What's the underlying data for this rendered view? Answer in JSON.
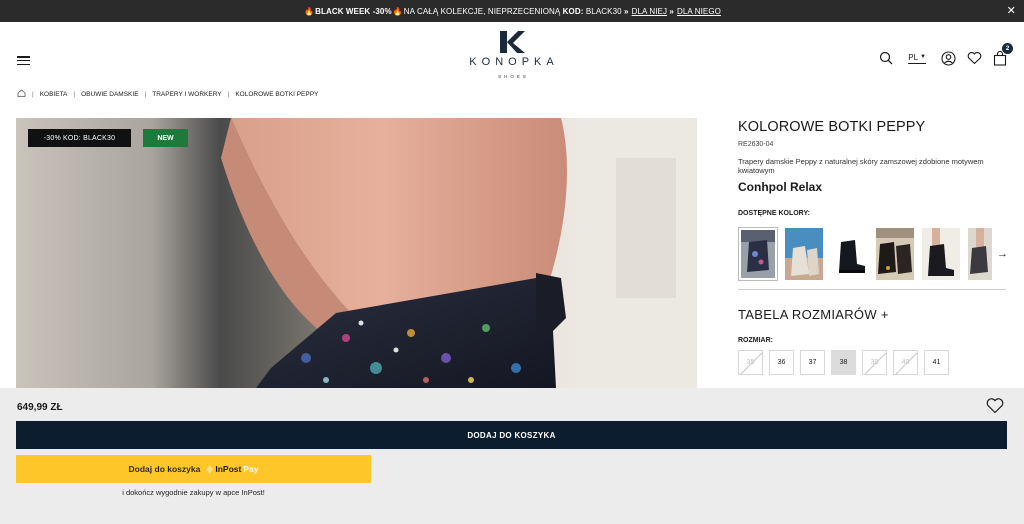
{
  "promo": {
    "part1": "BLACK WEEK -30%",
    "part2": "NA CAŁĄ KOLEKCJE, NIEPRZECENIONĄ",
    "code_label": "KOD:",
    "code": "BLACK30",
    "link1": "DLA NIEJ",
    "link2": "DLA NIEGO",
    "arrows": "»",
    "close": "✕"
  },
  "logo": {
    "name": "KONOPKA",
    "sub": "SHOES"
  },
  "header": {
    "language": "PL",
    "cart_count": "2"
  },
  "breadcrumb": [
    "KOBIETA",
    "OBUWIE DAMSKIE",
    "TRAPERY I WORKERY",
    "KOLOROWE BOTKI PEPPY"
  ],
  "badges": {
    "promo": "-30% KOD: BLACK30",
    "new": "NEW"
  },
  "product": {
    "title": "KOLOROWE BOTKI PEPPY",
    "sku": "RE2630-04",
    "description": "Trapery damskie Peppy z naturalnej skóry zamszowej zdobione motywem kwiatowym",
    "brand": "Conhpol Relax",
    "colors_label": "DOSTĘPNE KOLORY:",
    "size_table": "TABELA ROZMIARÓW +",
    "size_label": "ROZMIAR:",
    "sizes": [
      {
        "label": "35",
        "available": false
      },
      {
        "label": "36",
        "available": true
      },
      {
        "label": "37",
        "available": true
      },
      {
        "label": "38",
        "available": true,
        "selected": true
      },
      {
        "label": "39",
        "available": false
      },
      {
        "label": "40",
        "available": false
      },
      {
        "label": "41",
        "available": true
      }
    ]
  },
  "bottom": {
    "price": "649,99 ZŁ",
    "add_to_cart": "DODAJ DO KOSZYKA",
    "inpost_label": "Dodaj do koszyka",
    "inpost_brand": "InPost",
    "inpost_pay": "Pay",
    "inpost_note": "i dokończ wygodnie zakupy w apce InPost!"
  },
  "colors": {
    "navy": "#0b1d2e",
    "promo_bg": "#2b2b2b",
    "new_badge": "#1d7a3a",
    "inpost_yellow": "#ffc62a"
  }
}
